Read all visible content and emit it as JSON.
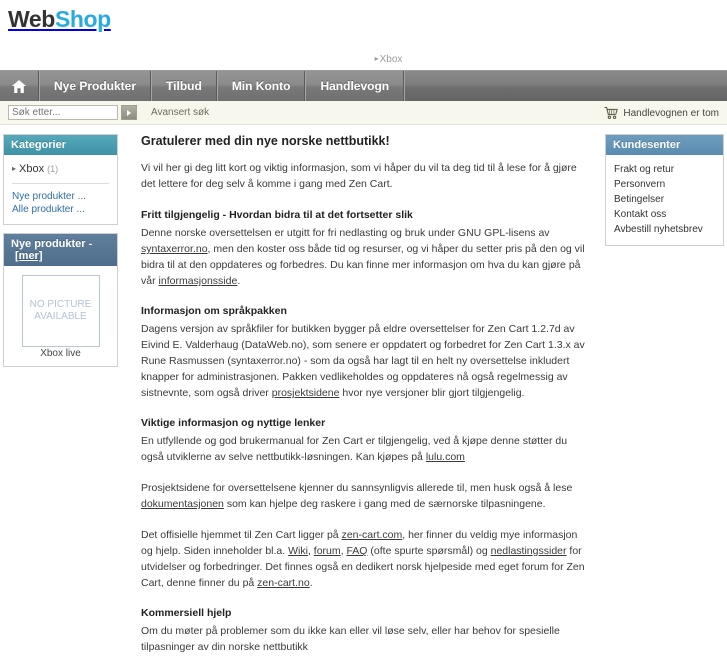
{
  "site": {
    "logo_primary": "Web",
    "logo_secondary": "Shop",
    "accent_color": "#29abe2"
  },
  "breadcrumb": {
    "arrow": "▸",
    "items": [
      "Xbox"
    ]
  },
  "nav": {
    "home_icon": "home-icon",
    "tabs": [
      {
        "label": "Nye Produkter"
      },
      {
        "label": "Tilbud"
      },
      {
        "label": "Min Konto"
      },
      {
        "label": "Handlevogn"
      }
    ]
  },
  "search": {
    "placeholder": "Søk etter...",
    "value": "",
    "go_icon": "arrow-right-icon",
    "advanced_label": "Avansert søk"
  },
  "cart": {
    "icon": "shopping-cart-icon",
    "status": "Handlevognen er tom"
  },
  "sidebar_left": {
    "categories": {
      "title": "Kategorier",
      "items": [
        {
          "arrow": "▸",
          "label": "Xbox",
          "count": "(1)"
        }
      ],
      "links": [
        {
          "label": "Nye produkter ..."
        },
        {
          "label": "Alle produkter ..."
        }
      ]
    },
    "new_products": {
      "title": "Nye produkter -",
      "more_label": "[mer]",
      "image_placeholder_line1": "NO PICTURE",
      "image_placeholder_line2": "AVAILABLE",
      "product_name": "Xbox live"
    }
  },
  "sidebar_right": {
    "customer_service": {
      "title": "Kundesenter",
      "items": [
        {
          "label": "Frakt og retur"
        },
        {
          "label": "Personvern"
        },
        {
          "label": "Betingelser"
        },
        {
          "label": "Kontakt oss"
        },
        {
          "label": "Avbestill nyhetsbrev"
        }
      ]
    }
  },
  "main": {
    "title": "Gratulerer med din nye norske nettbutikk!",
    "intro": "Vi vil her gi deg litt kort og viktig informasjon, som vi håper du vil ta deg tid til å lese for å gjøre det lettere for deg selv å komme i gang med Zen Cart.",
    "sections": [
      {
        "heading": "Fritt tilgjengelig - Hvordan bidra til at det fortsetter slik",
        "body_1": "Denne norske oversettelsen er utgitt for fri nedlasting og bruk under GNU GPL-lisens av ",
        "link_1": "syntaxerror.no",
        "body_2": ", men den koster oss både tid og resurser, og vi håper du setter pris på den og vil bidra til at den oppdateres og forbedres. Du kan finne mer informasjon om hva du kan gjøre på vår ",
        "link_2": "informasjonsside",
        "body_3": "."
      },
      {
        "heading": "Informasjon om språkpakken",
        "body_1": "Dagens versjon av språkfiler for butikken bygger på eldre oversettelser for Zen Cart 1.2.7d av Eivind E. Valderhaug (DataWeb.no), som senere er oppdatert og forbedret for Zen Cart 1.3.x av Rune Rasmussen (syntaxerror.no) - som da også har lagt til en helt ny oversettelse inkludert knapper for administrasjonen. Pakken vedlikeholdes og oppdateres nå også regelmessig av sistnevnte, som også driver ",
        "link_1": "prosjektsidene",
        "body_2": " hvor nye versjoner blir gjort tilgjengelig."
      },
      {
        "heading": "Viktige informasjon og nyttige lenker",
        "body_1": "En utfyllende og god brukermanual for Zen Cart er tilgjengelig, ved å kjøpe denne støtter du også utviklerne av selve nettbutikk-løsningen. Kan kjøpes på ",
        "link_1": "lulu.com",
        "body_2": ""
      },
      {
        "heading": "",
        "body_1": "Prosjektsidene for oversettelsene kjenner du sannsynligvis allerede til, men husk også å lese ",
        "link_1": "dokumentasjonen",
        "body_2": " som kan hjelpe deg raskere i gang med de særnorske tilpasningene."
      },
      {
        "heading": "",
        "body_1": "Det offisielle hjemmet til Zen Cart ligger på ",
        "link_1": "zen-cart.com",
        "body_2": ", her finner du veldig mye informasjon og hjelp. Siden inneholder bl.a. ",
        "link_2": "Wiki",
        "body_3": ", ",
        "link_3": "forum",
        "body_4": ", ",
        "link_4": "FAQ",
        "body_5": " (ofte spurte spørsmål) og ",
        "link_5": "nedlastingssider",
        "body_6": " for utvidelser og forbedringer. Det finnes også en dedikert norsk hjelpeside med eget forum for Zen Cart, denne finner du på ",
        "link_6": "zen-cart.no",
        "body_7": "."
      },
      {
        "heading": "Kommersiell hjelp",
        "body_1": "Om du møter på problemer som du ikke kan eller vil løse selv, eller har behov for spesielle tilpasninger av din norske nettbutikk",
        "link_1": "",
        "body_2": ""
      }
    ]
  }
}
